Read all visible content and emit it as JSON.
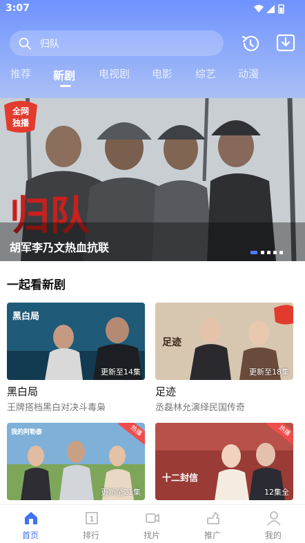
{
  "status_bar": {
    "time": "3:07"
  },
  "search": {
    "query": "归队"
  },
  "tabs": [
    {
      "label": "推荐"
    },
    {
      "label": "新剧"
    },
    {
      "label": "电视剧"
    },
    {
      "label": "电影"
    },
    {
      "label": "综艺"
    },
    {
      "label": "动漫"
    }
  ],
  "active_tab": "新剧",
  "banner": {
    "title_art": "归队",
    "badge": "全网独播",
    "caption": "胡军李乃文热血抗联",
    "slide_count": 5,
    "current_slide": 1
  },
  "section": {
    "title": "一起看新剧"
  },
  "cards": [
    {
      "poster_text": "黑白局",
      "episode": "更新至14集",
      "name": "黑白局",
      "desc": "王牌搭档黑白对决斗毒枭",
      "hot": false
    },
    {
      "poster_text": "足迹",
      "episode": "更新至18集",
      "name": "足迹",
      "desc": "丞磊林允演绎民国传奇",
      "hot": false
    },
    {
      "poster_text": "我的阿勒泰",
      "episode": "更新至21集",
      "name": "",
      "desc": "",
      "hot": true,
      "hot_label": "热播"
    },
    {
      "poster_text": "十二封信",
      "episode": "12集全",
      "name": "",
      "desc": "",
      "hot": true,
      "hot_label": "热播"
    }
  ],
  "bottom_nav": [
    {
      "label": "首页",
      "icon": "home-icon",
      "active": true
    },
    {
      "label": "排行",
      "icon": "ranking-icon",
      "active": false
    },
    {
      "label": "找片",
      "icon": "video-search-icon",
      "active": false
    },
    {
      "label": "推广",
      "icon": "share-icon",
      "active": false
    },
    {
      "label": "我的",
      "icon": "profile-icon",
      "active": false
    }
  ],
  "colors": {
    "accent": "#3f72f5",
    "header_top": "#6f93ff",
    "hot_badge": "#ef4d4d"
  }
}
